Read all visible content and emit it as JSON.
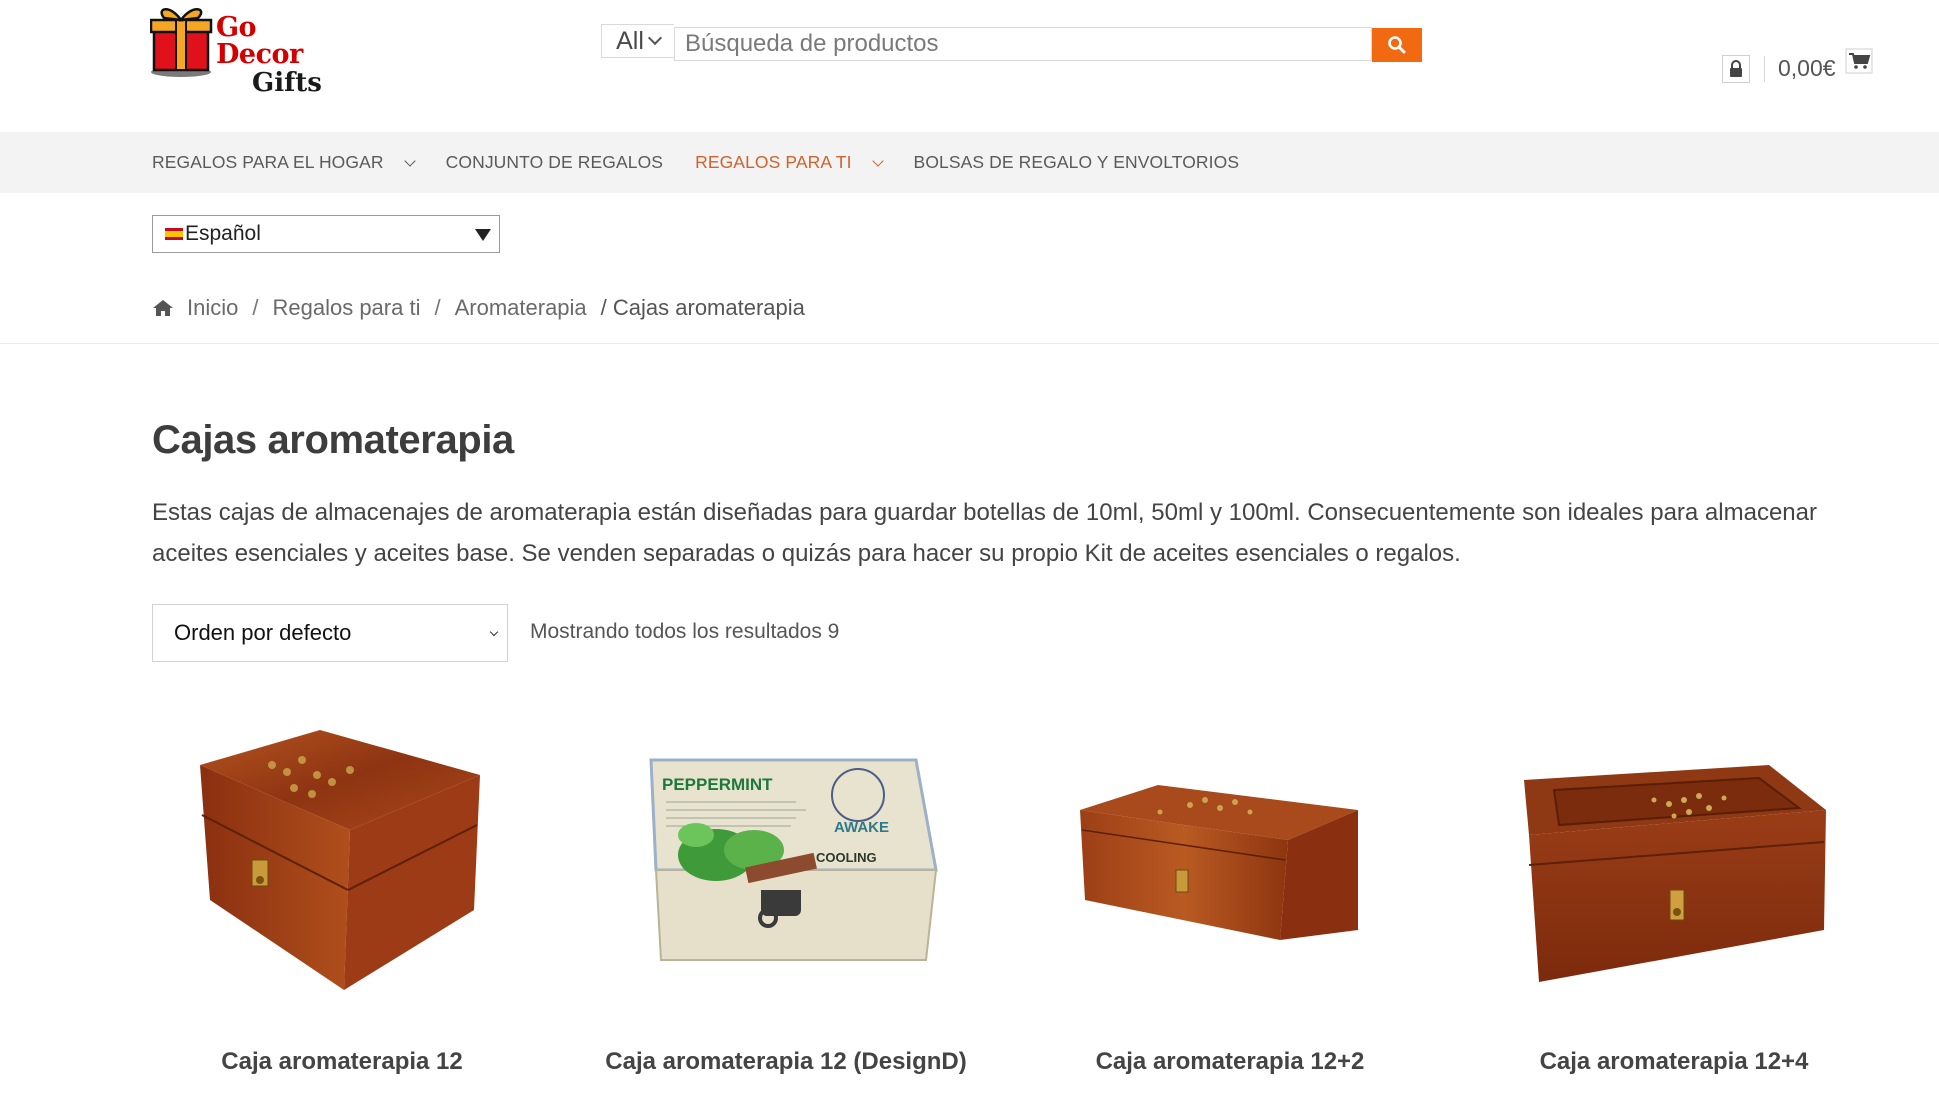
{
  "brand": {
    "line1": "Go Decor",
    "line2": "Gifts"
  },
  "search": {
    "category": "All",
    "placeholder": "Búsqueda de productos"
  },
  "cart": {
    "total": "0,00€"
  },
  "nav": {
    "items": [
      {
        "label": "REGALOS PARA EL HOGAR",
        "has_dropdown": true,
        "active": false
      },
      {
        "label": "CONJUNTO DE REGALOS",
        "has_dropdown": false,
        "active": false
      },
      {
        "label": "REGALOS PARA TI",
        "has_dropdown": true,
        "active": true
      },
      {
        "label": "BOLSAS DE REGALO Y ENVOLTORIOS",
        "has_dropdown": false,
        "active": false
      }
    ]
  },
  "language": {
    "selected": "Español"
  },
  "breadcrumb": {
    "items": [
      "Inicio",
      "Regalos para ti",
      "Aromaterapia"
    ],
    "current": "/ Cajas aromaterapia"
  },
  "page": {
    "title": "Cajas aromaterapia",
    "description": "Estas cajas de almacenajes de aromaterapia están diseñadas para guardar botellas de 10ml, 50ml y 100ml. Consecuentemente son ideales para almacenar aceites esenciales y aceites base. Se venden separadas o quizás para hacer su propio Kit de aceites esenciales o regalos."
  },
  "catalog": {
    "orderby": "Orden por defecto",
    "result_count": "Mostrando todos los resultados 9"
  },
  "products": [
    {
      "name": "Caja aromaterapia 12"
    },
    {
      "name": "Caja aromaterapia 12 (DesignD)"
    },
    {
      "name": "Caja aromaterapia 12+2"
    },
    {
      "name": "Caja aromaterapia 12+4"
    }
  ],
  "product_image_text": {
    "peppermint": "PEPPERMINT",
    "awake": "AWAKE",
    "cooling": "COOLING"
  },
  "colors": {
    "accent": "#f16a12",
    "nav_active": "#d2612c",
    "logo_red": "#d40000",
    "wood": "#9a3f1a"
  }
}
